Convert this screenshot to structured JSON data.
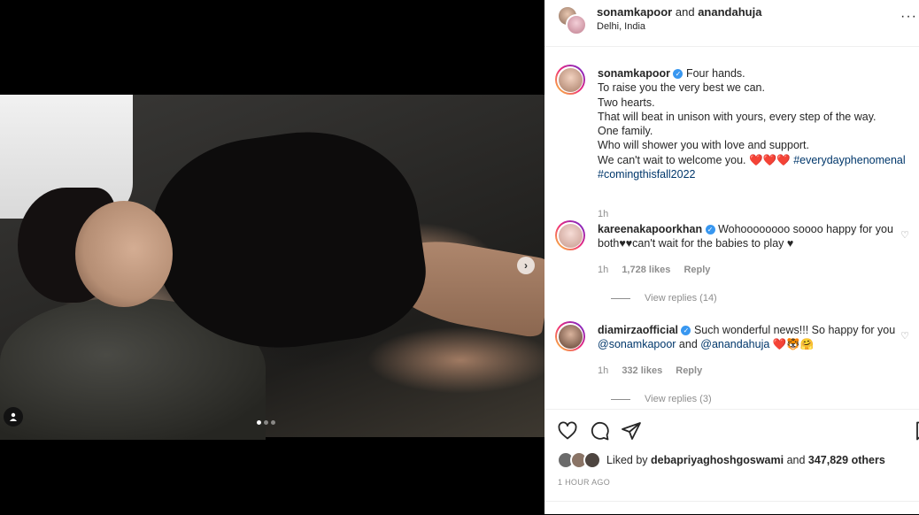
{
  "post": {
    "header": {
      "user1": "sonamkapoor",
      "connector": "and",
      "user2": "anandahuja",
      "location": "Delhi, India",
      "more_icon": "more-horizontal-icon"
    },
    "media": {
      "carousel_count": 3,
      "active_index": 0,
      "next_icon": "chevron-right-icon",
      "tag_icon": "user-tag-icon"
    },
    "caption": {
      "username": "sonamkapoor",
      "lines": [
        "Four hands.",
        "To raise you the very best we can.",
        "Two hearts.",
        "That will beat in unison with yours, every step of the way.",
        "One family.",
        "Who will shower you with love and support.",
        "We can't wait to welcome you."
      ],
      "hearts": "❤️❤️❤️",
      "hashtags": [
        "#everydayphenomenal",
        "#comingthisfall2022"
      ],
      "time": "1h"
    },
    "comments": [
      {
        "username": "kareenakapoorkhan",
        "text": "Wohoooooooo soooo happy for you both♥♥can't wait for the babies to play ♥",
        "time": "1h",
        "likes": "1,728 likes",
        "reply": "Reply",
        "view_replies": "View replies (14)"
      },
      {
        "username": "diamirzaofficial",
        "text_before": "Such wonderful news!!! So happy for you",
        "mention1": "@sonamkapoor",
        "and": "and",
        "mention2": "@anandahuja",
        "emoji": "❤️🐯🤗",
        "time": "1h",
        "likes": "332 likes",
        "reply": "Reply",
        "view_replies": "View replies (3)"
      }
    ],
    "likes": {
      "prefix": "Liked by",
      "user": "debapriyaghoshgoswami",
      "and": "and",
      "others": "347,829 others"
    },
    "timestamp": "1 HOUR AGO",
    "colors": {
      "link": "#00376b",
      "muted": "#8e8e8e",
      "verified": "#3897f0",
      "heart": "#ed1c2e"
    }
  }
}
